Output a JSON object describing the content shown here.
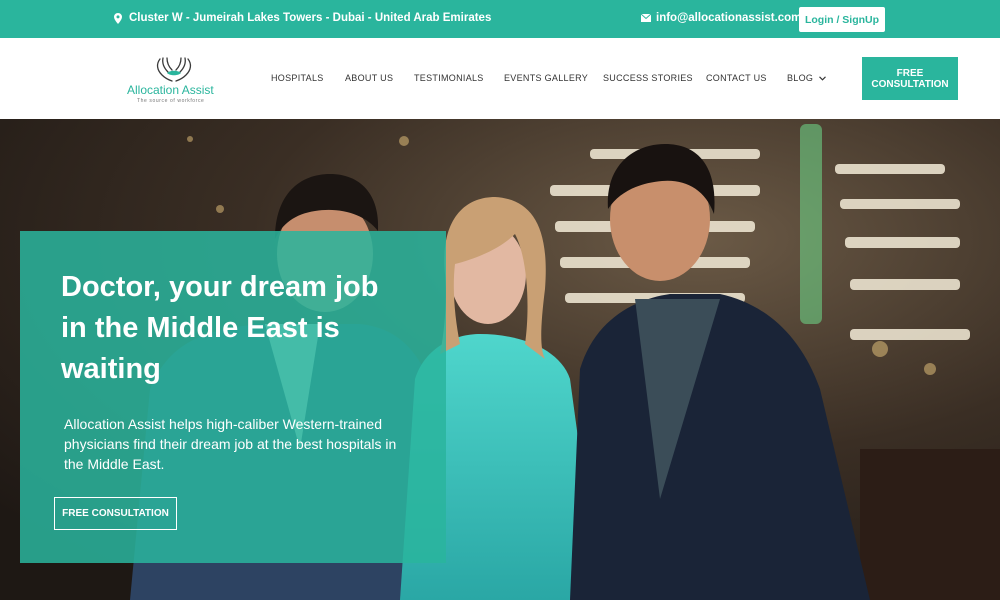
{
  "topbar": {
    "location": "Cluster W - Jumeirah Lakes Towers - Dubai - United Arab Emirates",
    "email": "info@allocationassist.com",
    "login_label": "Login / SignUp"
  },
  "header": {
    "brand_name": "Allocation Assist",
    "brand_tagline": "The source of workforce",
    "nav": [
      {
        "label": "HOSPITALS"
      },
      {
        "label": "ABOUT US"
      },
      {
        "label": "TESTIMONIALS"
      },
      {
        "label": "EVENTS GALLERY"
      },
      {
        "label": "SUCCESS STORIES"
      },
      {
        "label": "CONTACT US"
      },
      {
        "label": "BLOG"
      }
    ],
    "cta_label": "FREE CONSULTATION"
  },
  "hero": {
    "title": "Doctor, your dream job in the Middle East is waiting",
    "subtitle": "Allocation Assist helps high-caliber Western-trained physicians find their dream job at the best hospitals in the Middle East.",
    "button_label": "FREE CONSULTATION"
  },
  "colors": {
    "brand": "#2ab59d"
  },
  "icons": [
    "map-pin-icon",
    "envelope-icon",
    "hands-logo-icon",
    "chevron-down-icon"
  ]
}
